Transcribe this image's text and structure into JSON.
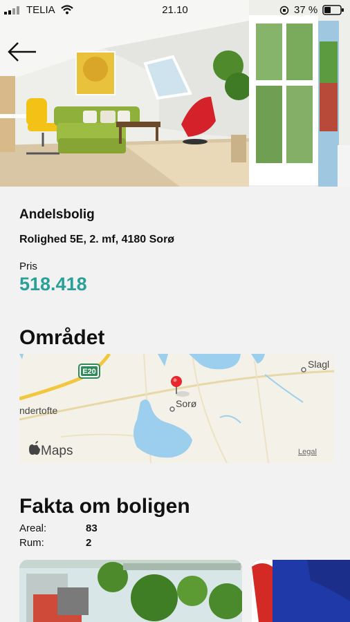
{
  "status_bar": {
    "carrier": "TELIA",
    "time": "21.10",
    "battery": "37 %"
  },
  "listing": {
    "type": "Andelsbolig",
    "address": "Rolighed 5E, 2. mf, 4180 Sorø",
    "price_label": "Pris",
    "price": "518.418"
  },
  "area_section": {
    "title": "Området",
    "map": {
      "road_badge": "E20",
      "town_label": "Sorø",
      "place_left": "ndertofte",
      "place_right": "Slagl",
      "provider": "Maps",
      "legal": "Legal"
    }
  },
  "facts_section": {
    "title": "Fakta om boligen",
    "rows": [
      {
        "label": "Areal:",
        "value": "83"
      },
      {
        "label": "Rum:",
        "value": "2"
      }
    ]
  },
  "colors": {
    "price": "#2aa198",
    "background": "#f2f2f2"
  }
}
